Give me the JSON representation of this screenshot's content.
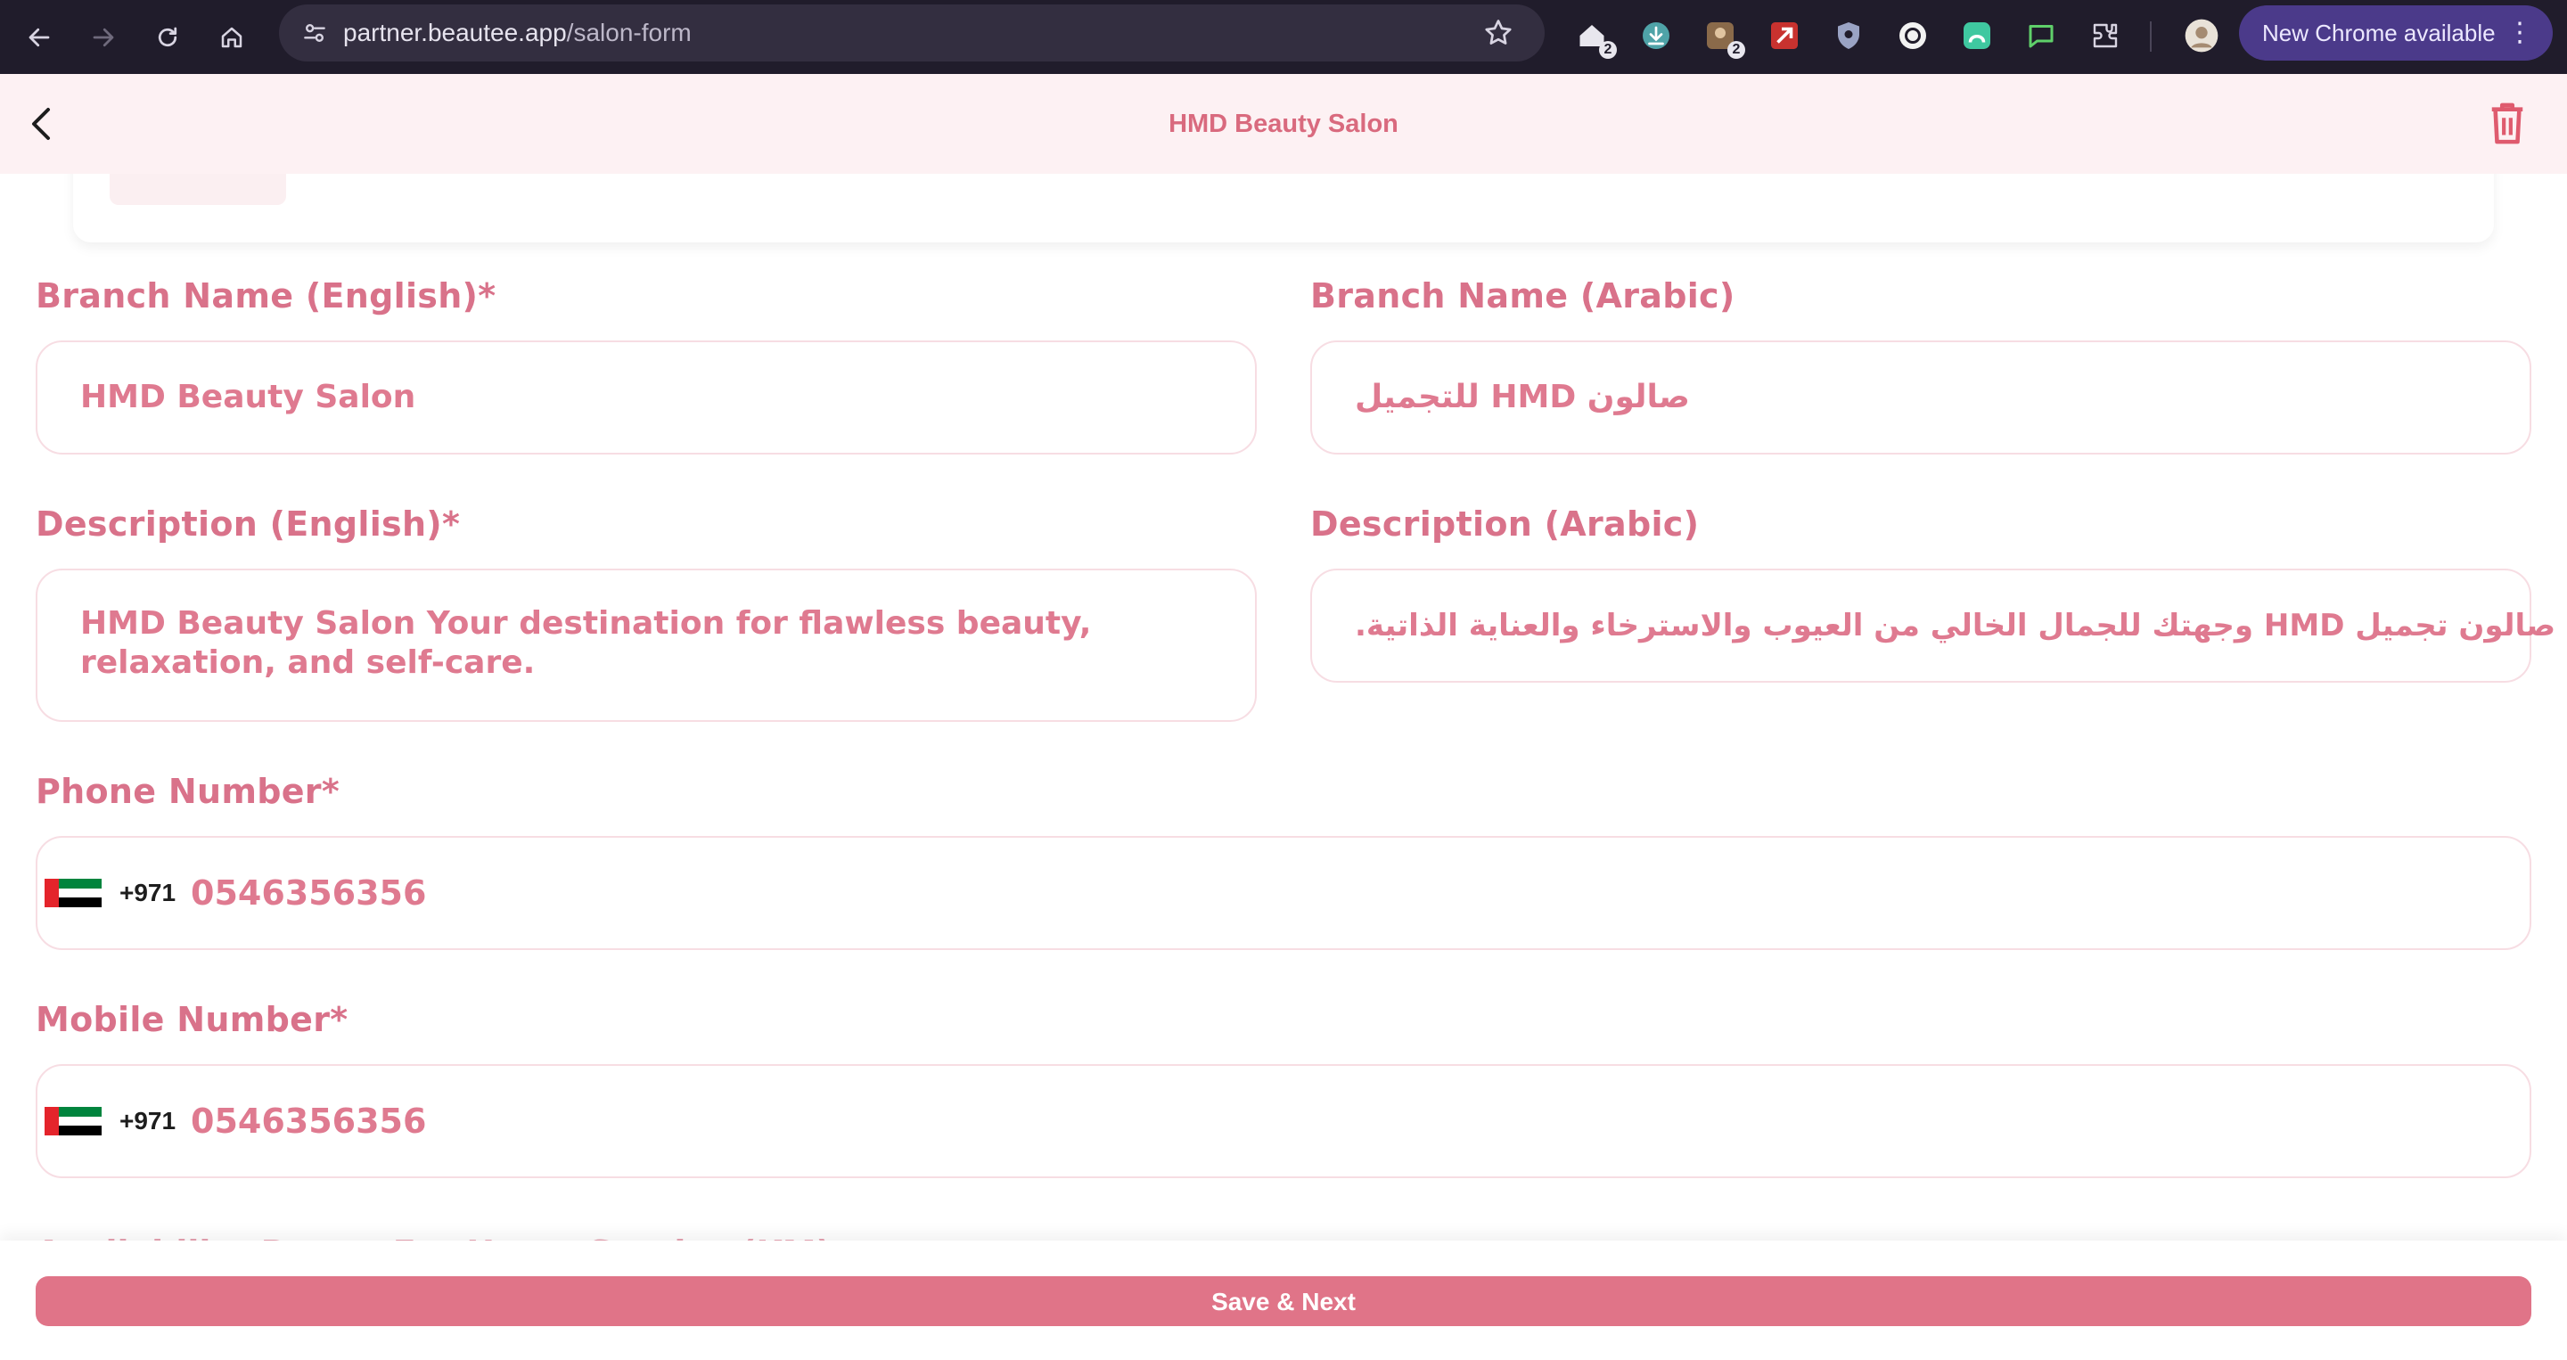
{
  "browser": {
    "url_host": "partner.beautee.app",
    "url_path": "/salon-form",
    "update_label": "New Chrome available",
    "ext_badges": [
      "2",
      "2"
    ]
  },
  "header": {
    "title": "HMD Beauty Salon"
  },
  "form": {
    "branch_name_en": {
      "label": "Branch Name (English)*",
      "value": "HMD Beauty Salon"
    },
    "branch_name_ar": {
      "label": "Branch Name (Arabic)",
      "value": "صالون HMD للتجميل"
    },
    "description_en": {
      "label": "Description (English)*",
      "value": "HMD Beauty Salon Your destination for flawless beauty, relaxation, and self-care."
    },
    "description_ar": {
      "label": "Description (Arabic)",
      "value": "صالون تجميل HMD وجهتك للجمال الخالي من العيوب والاسترخاء والعناية الذاتية."
    },
    "phone": {
      "label": "Phone Number*",
      "country_code": "+971",
      "value": "0546356356"
    },
    "mobile": {
      "label": "Mobile Number*",
      "country_code": "+971",
      "value": "0546356356"
    },
    "next_section_label": "Availability Range For Home Service (KM)"
  },
  "actions": {
    "save_next_label": "Save & Next"
  },
  "colors": {
    "accent": "#e07488",
    "label": "#d9728a",
    "header_bg": "#fdf1f3",
    "field_border": "#f7dde3"
  }
}
